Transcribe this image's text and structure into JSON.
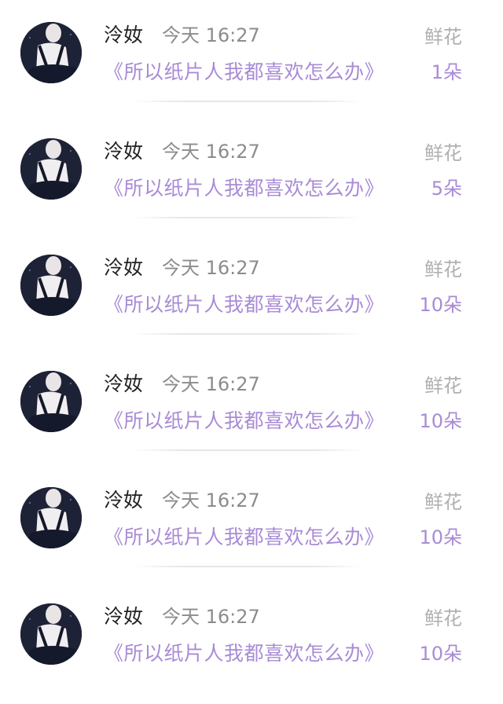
{
  "colors": {
    "accent": "#a98bd6",
    "name": "#222222",
    "time": "#8c8c8c",
    "gift_label": "#b0b0b0"
  },
  "items": [
    {
      "author": "泠奻",
      "time": "今天 16:27",
      "title": "《所以纸片人我都喜欢怎么办》",
      "gift_label": "鲜花",
      "gift_count": "1朵",
      "avatar_icon": "user-avatar-photo"
    },
    {
      "author": "泠奻",
      "time": "今天 16:27",
      "title": "《所以纸片人我都喜欢怎么办》",
      "gift_label": "鲜花",
      "gift_count": "5朵",
      "avatar_icon": "user-avatar-photo"
    },
    {
      "author": "泠奻",
      "time": "今天 16:27",
      "title": "《所以纸片人我都喜欢怎么办》",
      "gift_label": "鲜花",
      "gift_count": "10朵",
      "avatar_icon": "user-avatar-photo"
    },
    {
      "author": "泠奻",
      "time": "今天 16:27",
      "title": "《所以纸片人我都喜欢怎么办》",
      "gift_label": "鲜花",
      "gift_count": "10朵",
      "avatar_icon": "user-avatar-photo"
    },
    {
      "author": "泠奻",
      "time": "今天 16:27",
      "title": "《所以纸片人我都喜欢怎么办》",
      "gift_label": "鲜花",
      "gift_count": "10朵",
      "avatar_icon": "user-avatar-photo"
    },
    {
      "author": "泠奻",
      "time": "今天 16:27",
      "title": "《所以纸片人我都喜欢怎么办》",
      "gift_label": "鲜花",
      "gift_count": "10朵",
      "avatar_icon": "user-avatar-photo"
    }
  ]
}
